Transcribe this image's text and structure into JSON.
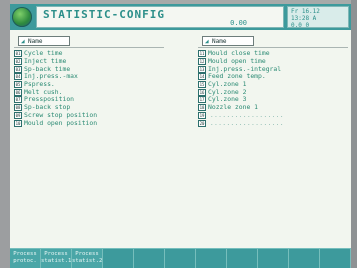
{
  "window": {
    "title": "STATISTIC-CONFIG",
    "time": "0.00",
    "status": [
      "Fr 16.12",
      "13:28 A",
      "0.0 0"
    ]
  },
  "left_column": {
    "header": "Name",
    "items": [
      {
        "num": "01",
        "label": "Cycle time"
      },
      {
        "num": "02",
        "label": "Inject time"
      },
      {
        "num": "03",
        "label": "Sp-back time"
      },
      {
        "num": "04",
        "label": "Inj.press.-max"
      },
      {
        "num": "05",
        "label": "Pspress."
      },
      {
        "num": "06",
        "label": "Melt cush."
      },
      {
        "num": "07",
        "label": "Pressposition"
      },
      {
        "num": "08",
        "label": "Sp-back stop"
      },
      {
        "num": "09",
        "label": "Screw stop position"
      },
      {
        "num": "10",
        "label": "Mould open position"
      }
    ]
  },
  "right_column": {
    "header": "Name",
    "items": [
      {
        "num": "11",
        "label": "Mould close time"
      },
      {
        "num": "12",
        "label": "Mould open time"
      },
      {
        "num": "13",
        "label": "Inj.press.-integral"
      },
      {
        "num": "14",
        "label": "Feed zone temp."
      },
      {
        "num": "15",
        "label": "Cyl.zone 1"
      },
      {
        "num": "16",
        "label": "Cyl.zone 2"
      },
      {
        "num": "17",
        "label": "Cyl.zone 3"
      },
      {
        "num": "18",
        "label": "Nozzle zone 1"
      },
      {
        "num": "19",
        "label": ""
      },
      {
        "num": "20",
        "label": ""
      }
    ]
  },
  "softkeys": [
    {
      "line1": "Process",
      "line2": "protoc."
    },
    {
      "line1": "Process",
      "line2": "statist.1"
    },
    {
      "line1": "Process",
      "line2": "statist.2"
    },
    {
      "line1": "",
      "line2": ""
    },
    {
      "line1": "",
      "line2": ""
    },
    {
      "line1": "",
      "line2": ""
    },
    {
      "line1": "",
      "line2": ""
    },
    {
      "line1": "",
      "line2": ""
    },
    {
      "line1": "",
      "line2": ""
    },
    {
      "line1": "",
      "line2": ""
    },
    {
      "line1": "",
      "line2": ""
    }
  ]
}
